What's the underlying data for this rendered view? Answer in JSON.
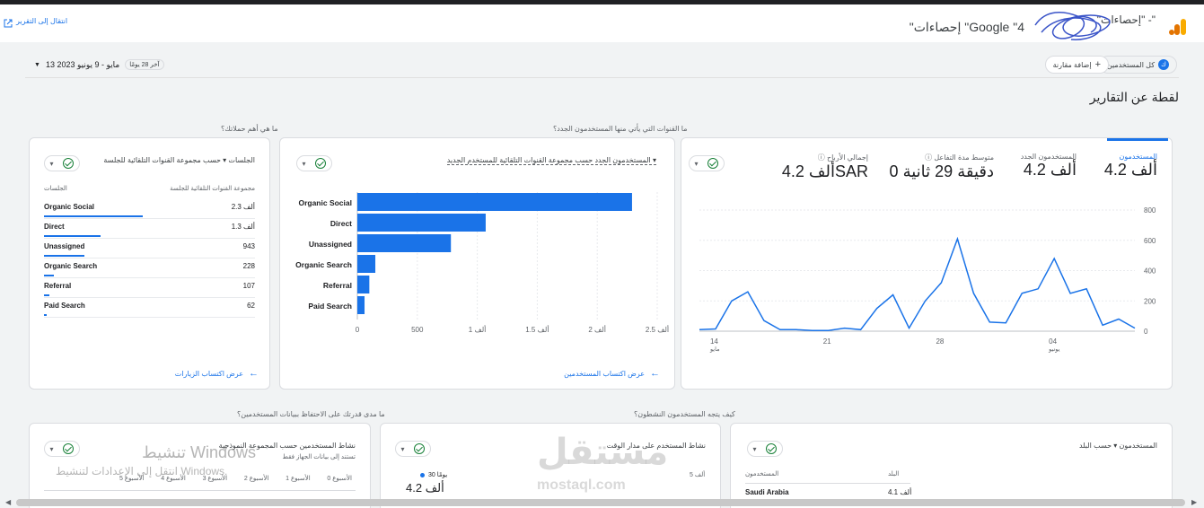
{
  "header": {
    "breadcrumb": "\"إحصاءات\" -\"",
    "title": "\"إحصاءات \"Google \"4",
    "goto_report": "انتقال إلى التقرير"
  },
  "subbar": {
    "all_users": "كل المستخدمين",
    "add_comparison": "إضافة مقارنة",
    "last_days": "آخر 28 يومًا",
    "date_range": "13 مايو - 9 يونيو 2023"
  },
  "page_title": "لقطة عن التقارير",
  "questions": {
    "channels": "ما القنوات التي يأتي منها المستخدمون الجدد؟",
    "campaigns": "ما هي أهم حملاتك؟",
    "trend": "كيف يتجه المستخدمون النشطون؟",
    "retention": "ما مدى قدرتك على الاحتفاظ ببيانات المستخدمين؟"
  },
  "overview": {
    "metrics": [
      {
        "label": "المستخدمون",
        "value": "4.2 ألف"
      },
      {
        "label": "المستخدمون الجدد",
        "value": "4.2 ألف"
      },
      {
        "label": "متوسط مدة التفاعل",
        "value": "0 دقيقة 29 ثانية"
      },
      {
        "label": "إجمالي الأرباح",
        "value": "4.2 ألفSAR"
      }
    ],
    "chart_data": {
      "type": "line",
      "y_ticks": [
        "800",
        "600",
        "400",
        "200",
        "0"
      ],
      "x_ticks": [
        {
          "day": "14",
          "month": "مايو"
        },
        {
          "day": "21",
          "month": ""
        },
        {
          "day": "28",
          "month": ""
        },
        {
          "day": "04",
          "month": "يونيو"
        }
      ],
      "ylim": [
        0,
        800
      ],
      "values": [
        10,
        15,
        200,
        260,
        70,
        10,
        10,
        5,
        5,
        20,
        10,
        150,
        240,
        20,
        200,
        320,
        610,
        250,
        60,
        55,
        250,
        280,
        480,
        250,
        280,
        40,
        80,
        20
      ]
    }
  },
  "channels_card": {
    "dimension": "المستخدمون الجدد حسب مجموعة القنوات التلقائية للمستخدم الجديد",
    "link": "عرض اكتساب المستخدمين",
    "chart_data": {
      "type": "bar",
      "categories": [
        "Organic Social",
        "Direct",
        "Unassigned",
        "Organic Search",
        "Referral",
        "Paid Search"
      ],
      "values": [
        2290,
        1070,
        780,
        150,
        100,
        60
      ],
      "x_ticks": [
        "0",
        "500",
        "1 ألف",
        "1.5 ألف",
        "2 ألف",
        "2.5 ألف"
      ],
      "xlim": [
        0,
        2500
      ]
    }
  },
  "sessions_card": {
    "dimension": "الجلسات ▾ حسب مجموعة القنوات التلقائية للجلسة",
    "col_dim": "مجموعة القنوات التلقائية للجلسة",
    "col_metric": "الجلسات",
    "rows": [
      {
        "name": "Organic Social",
        "value": "2.3 ألف",
        "share": 1.0
      },
      {
        "name": "Direct",
        "value": "1.3 ألف",
        "share": 0.57
      },
      {
        "name": "Unassigned",
        "value": "943",
        "share": 0.41
      },
      {
        "name": "Organic Search",
        "value": "228",
        "share": 0.1
      },
      {
        "name": "Referral",
        "value": "107",
        "share": 0.05
      },
      {
        "name": "Paid Search",
        "value": "62",
        "share": 0.03
      }
    ],
    "link": "عرض اكتساب الزيارات"
  },
  "bottom": {
    "country_card": {
      "dimension": "المستخدمون ▾ حسب البلد",
      "col_country": "البلد",
      "col_users": "المستخدمون",
      "row_country": "Saudi Arabia",
      "row_value": "4.1 ألف"
    },
    "activity_card": {
      "title": "نشاط المستخدم على مدار الوقت",
      "legend": "30 يومًا",
      "value": "4.2 ألف",
      "tick": "5 ألف"
    },
    "cohort_card": {
      "title": "نشاط المستخدمين حسب المجموعة النموذجية",
      "subtitle": "تستند إلى بيانات الجهاز فقط",
      "weeks": [
        "الأسبوع 5",
        "الأسبوع 4",
        "الأسبوع 3",
        "الأسبوع 2",
        "الأسبوع 1",
        "الأسبوع 0"
      ]
    }
  },
  "watermark": {
    "line1": "تنشيط Windows",
    "line2": "انتقل إلى الإعدادات لتنشيط Windows.",
    "brand": "مستقل",
    "brand_url": "mostaql.com"
  },
  "colors": {
    "accent": "#1a73e8",
    "check": "#188038"
  }
}
